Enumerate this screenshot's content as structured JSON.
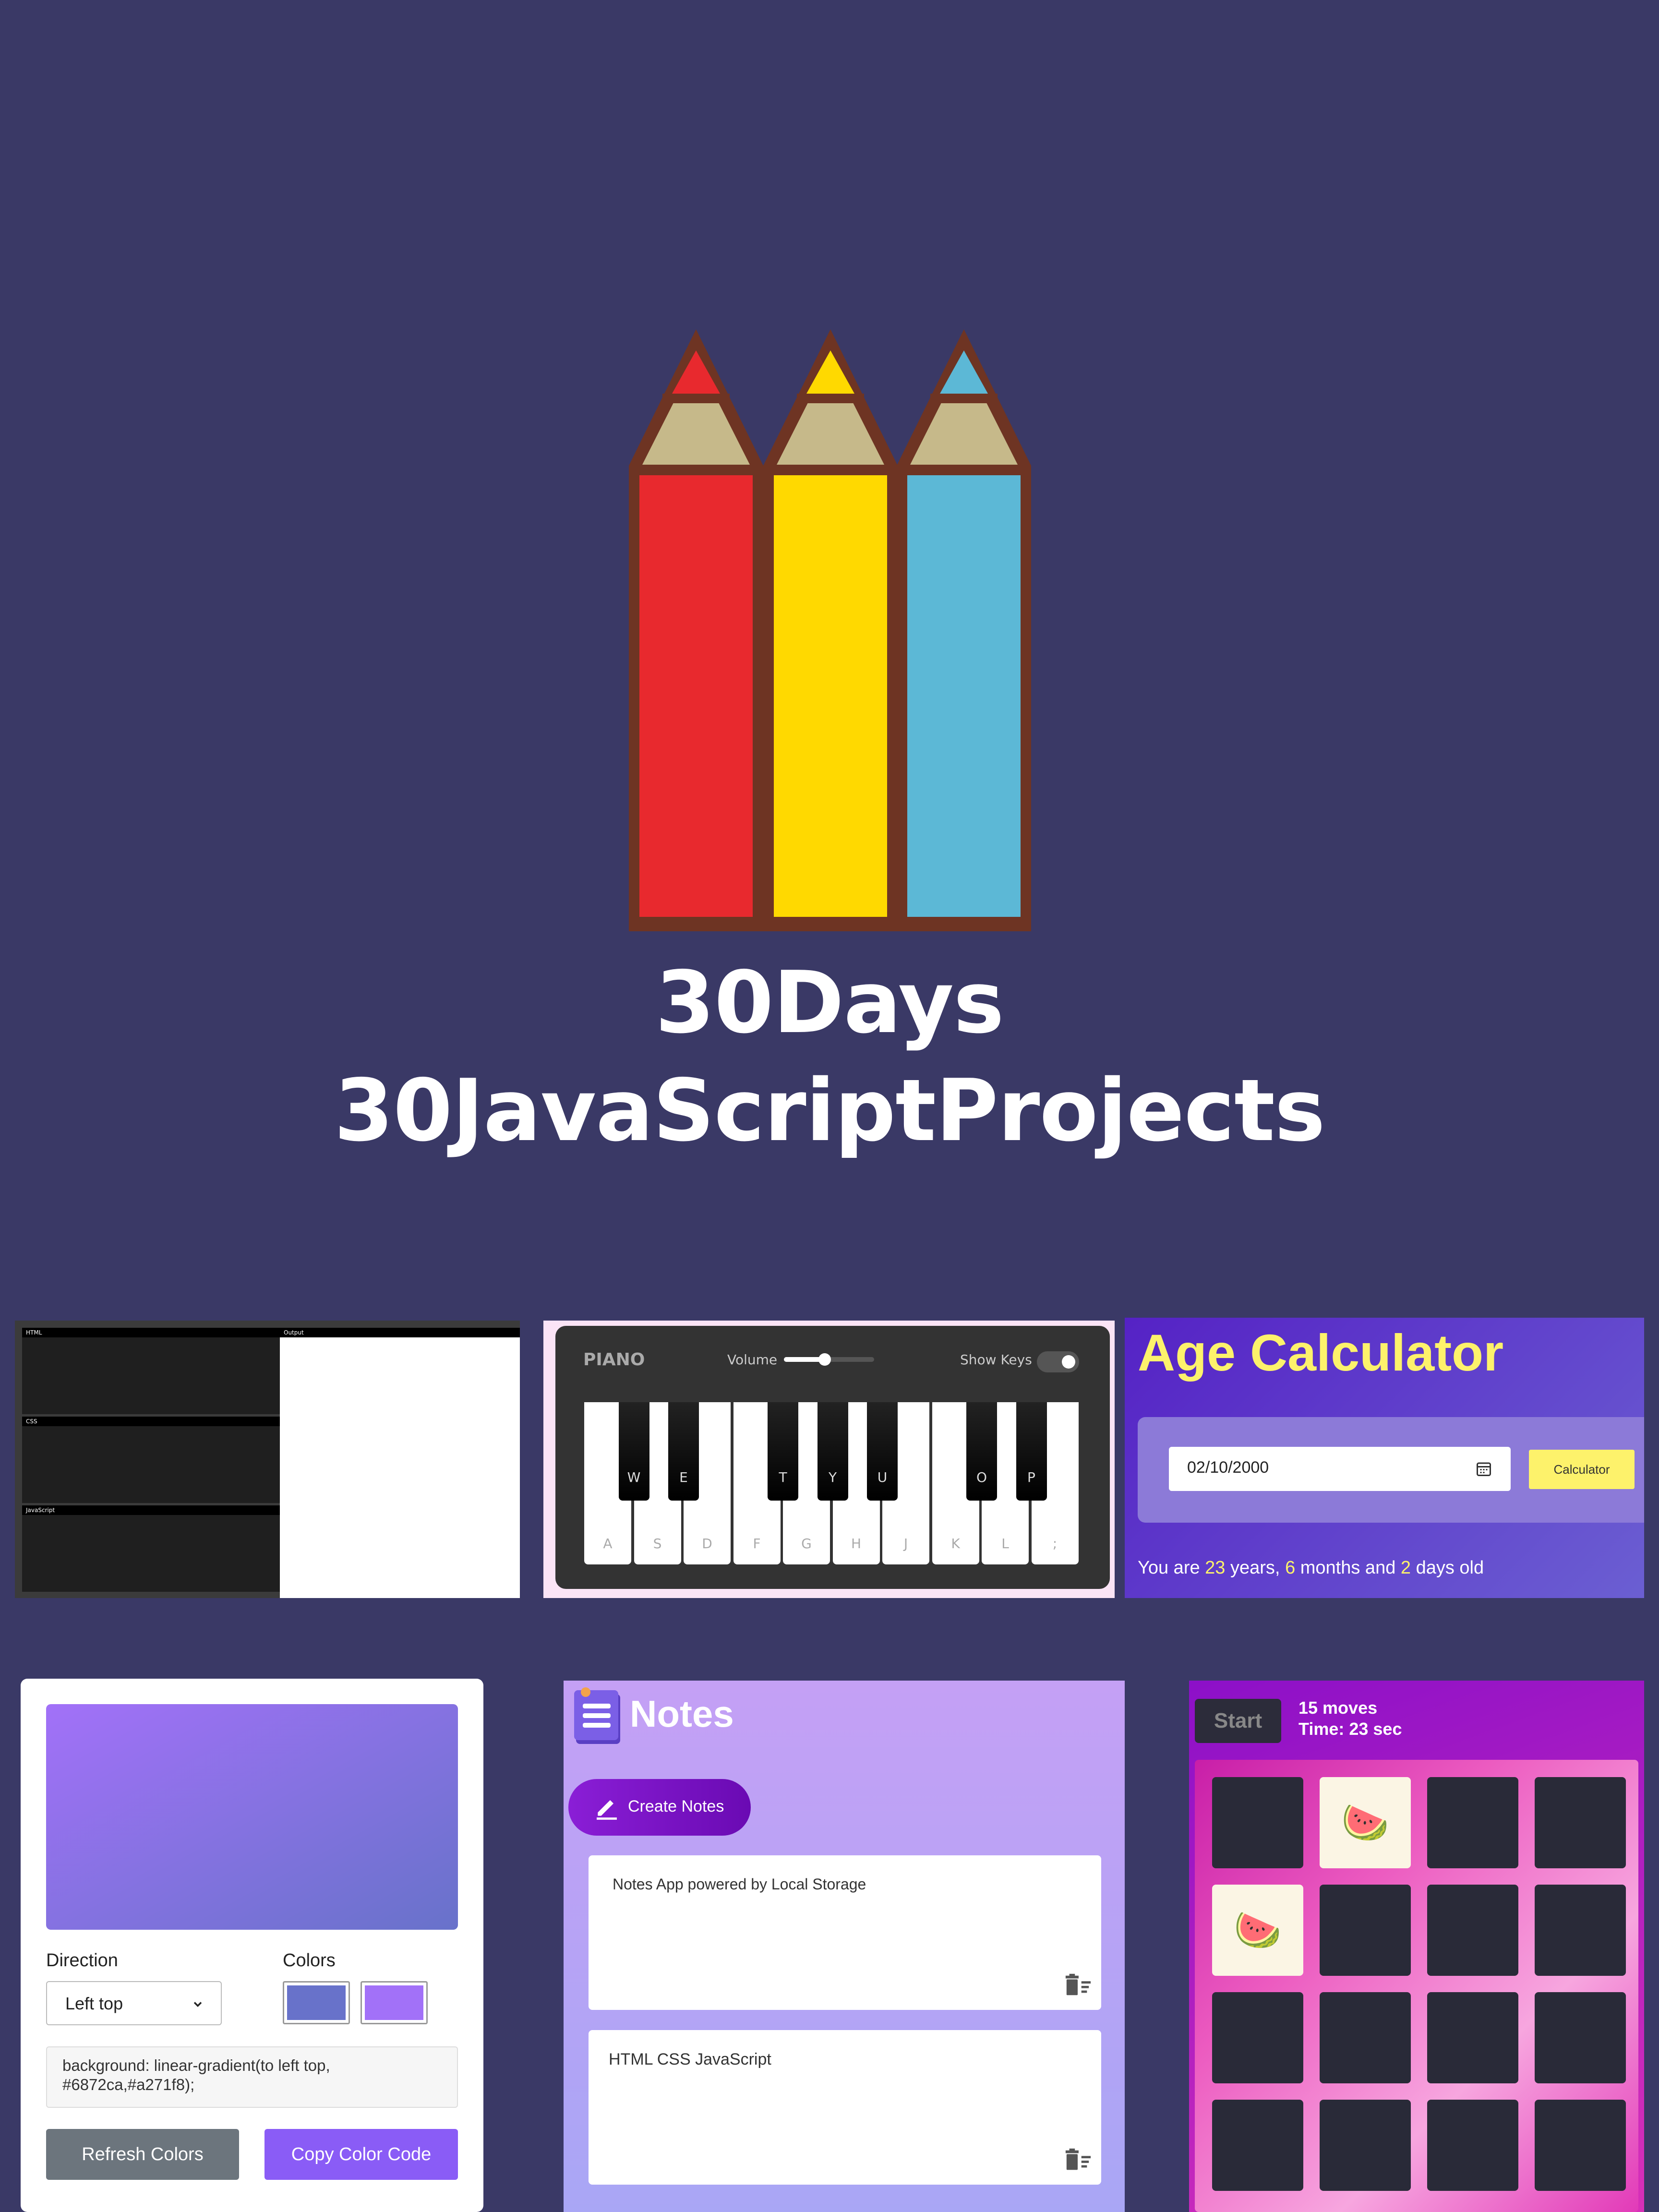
{
  "hero": {
    "title_line1": "30Days",
    "title_line2": "30JavaScriptProjects",
    "pencil_colors": [
      "#e8292e",
      "#ffd900",
      "#5cb8d6"
    ]
  },
  "editor": {
    "panes": [
      "HTML",
      "CSS",
      "JavaScript"
    ],
    "output_label": "Output"
  },
  "piano": {
    "title": "PIANO",
    "volume_label": "Volume",
    "volume_level": 0.45,
    "show_keys_label": "Show Keys",
    "show_keys_on": true,
    "white_keys": [
      "A",
      "S",
      "D",
      "F",
      "G",
      "H",
      "J",
      "K",
      "L",
      ";"
    ],
    "black_keys": [
      "W",
      "E",
      "T",
      "Y",
      "U",
      "O",
      "P"
    ]
  },
  "age_calculator": {
    "title": "Age Calculator",
    "date_value": "02/10/2000",
    "button_label": "Calculator",
    "result_prefix": "You are ",
    "years": "23",
    "years_label": " years, ",
    "months": "6",
    "months_label": " months and ",
    "days": "2",
    "days_label": " days old"
  },
  "gradient_generator": {
    "direction_label": "Direction",
    "direction_value": "Left top",
    "colors_label": "Colors",
    "color1": "#6872ca",
    "color2": "#a271f8",
    "code_text": "background: linear-gradient(to left top, #6872ca,#a271f8);",
    "refresh_label": "Refresh Colors",
    "copy_label": "Copy Color Code"
  },
  "notes": {
    "title": "Notes",
    "create_label": "Create Notes",
    "items": [
      "Notes App powered by Local Storage",
      "HTML CSS JavaScript"
    ]
  },
  "memory_game": {
    "start_label": "Start",
    "moves_text": "15 moves",
    "time_text": "Time: 23 sec",
    "open_cards": [
      1,
      4
    ],
    "open_emoji": "🍉"
  }
}
